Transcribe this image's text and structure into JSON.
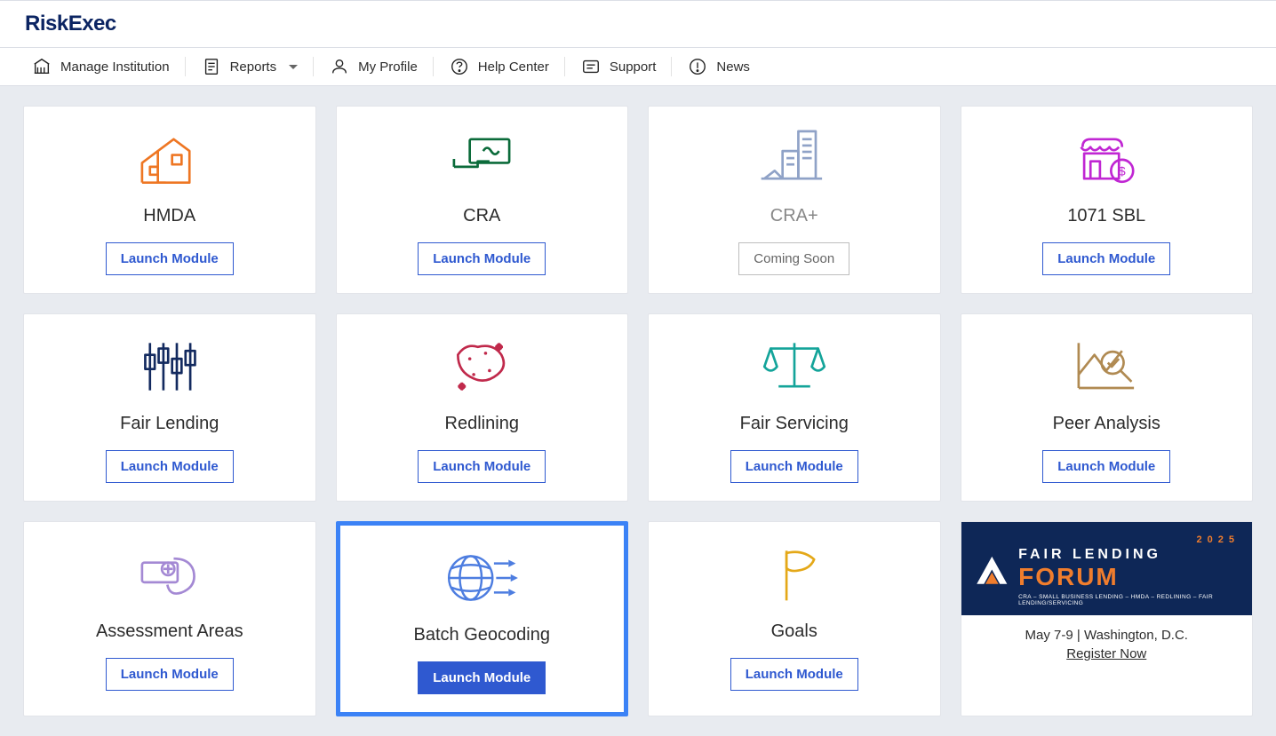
{
  "brand": "RiskExec",
  "nav": {
    "manage": "Manage Institution",
    "reports": "Reports",
    "profile": "My Profile",
    "help": "Help Center",
    "support": "Support",
    "news": "News"
  },
  "btn": {
    "launch": "Launch Module",
    "coming": "Coming Soon"
  },
  "cards": {
    "hmda": "HMDA",
    "cra": "CRA",
    "craplus": "CRA+",
    "sbl": "1071 SBL",
    "fairlending": "Fair Lending",
    "redlining": "Redlining",
    "fairservicing": "Fair Servicing",
    "peer": "Peer Analysis",
    "assessment": "Assessment Areas",
    "batchgeo": "Batch Geocoding",
    "goals": "Goals"
  },
  "promo": {
    "year": "2025",
    "line1": "FAIR LENDING",
    "forum": "FORUM",
    "sub": "CRA – SMALL BUSINESS LENDING – HMDA – REDLINING – FAIR LENDING/SERVICING",
    "date": "May 7-9 | Washington, D.C.",
    "register": "Register Now"
  }
}
